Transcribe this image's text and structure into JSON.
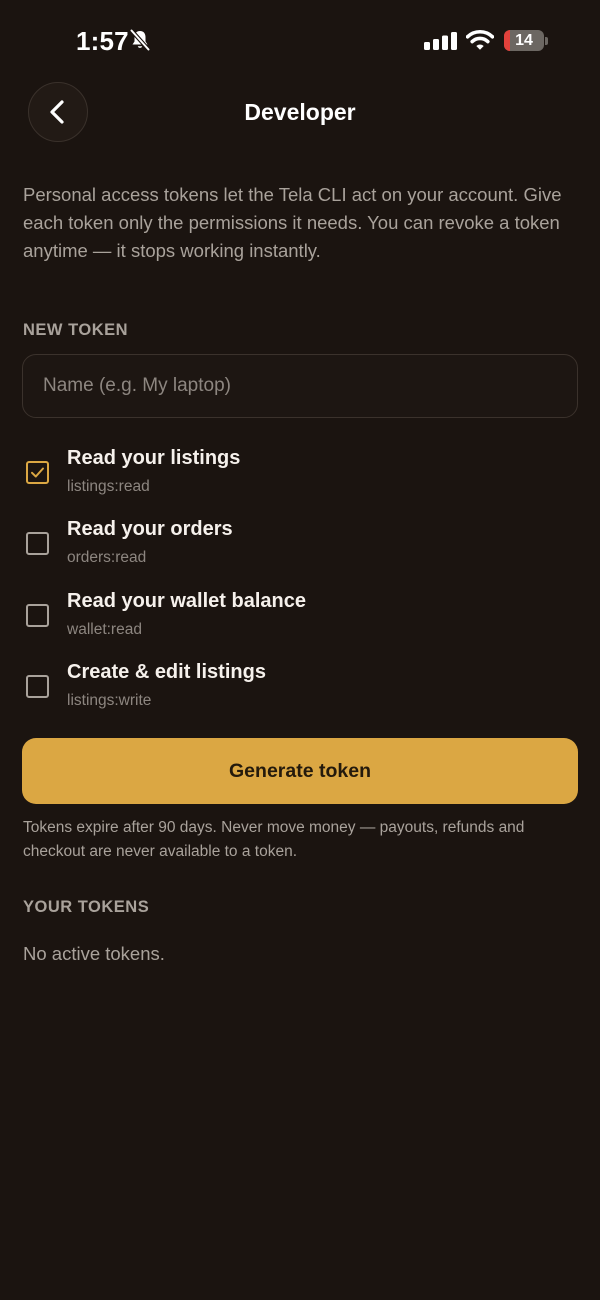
{
  "status_bar": {
    "time": "1:57",
    "battery_level": "14",
    "battery_fraction": 0.14,
    "battery_color": "#e2413b",
    "icons": [
      "bell-slash-icon",
      "signal-icon",
      "wifi-icon",
      "battery-icon"
    ]
  },
  "header": {
    "title": "Developer",
    "back_icon": "chevron-left-icon"
  },
  "intro": {
    "text": "Personal access tokens let the Tela CLI act on your account. Give each token only the permissions it needs. You can revoke a token anytime — it stops working instantly."
  },
  "new_token": {
    "heading": "NEW TOKEN",
    "name_value": "",
    "name_placeholder": "Name (e.g. My laptop)",
    "permissions": [
      {
        "title": "Read your listings",
        "scope": "listings:read",
        "checked": true
      },
      {
        "title": "Read your orders",
        "scope": "orders:read",
        "checked": false
      },
      {
        "title": "Read your wallet balance",
        "scope": "wallet:read",
        "checked": false
      },
      {
        "title": "Create & edit listings",
        "scope": "listings:write",
        "checked": false
      }
    ],
    "generate_label": "Generate token",
    "footnote": "Tokens expire after 90 days. Never move money — payouts, refunds and checkout are never available to a token."
  },
  "your_tokens": {
    "heading": "YOUR TOKENS",
    "empty_text": "No active tokens."
  },
  "colors": {
    "background": "#1b1410",
    "accent": "#dba743",
    "text_primary": "#f6f1ec",
    "text_secondary": "#a9a29b"
  }
}
